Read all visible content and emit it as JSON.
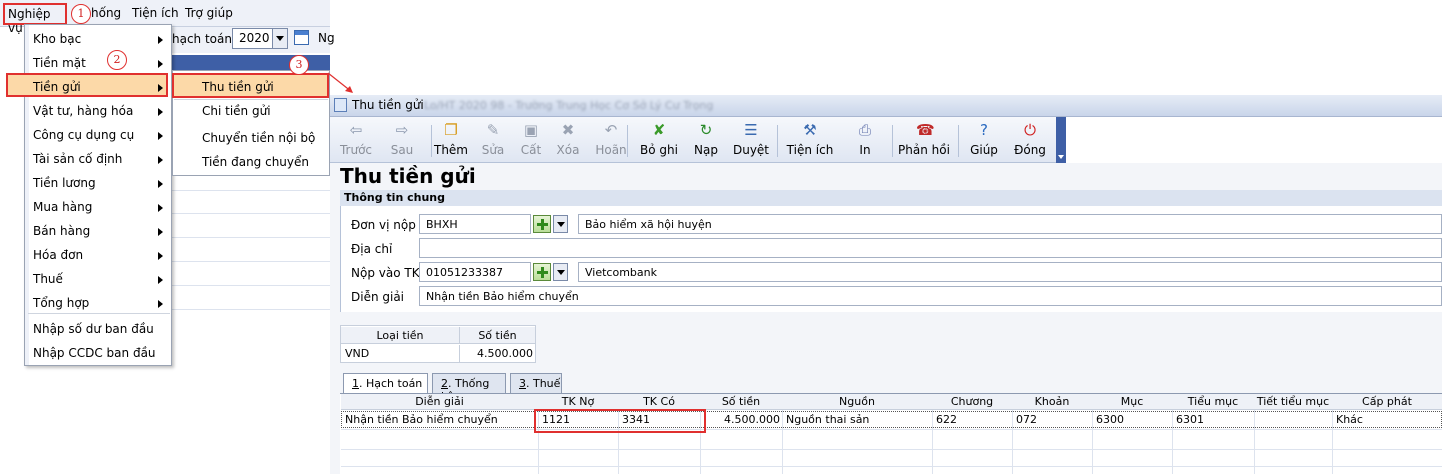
{
  "menubar": {
    "items": [
      "Nghiệp vụ",
      "hống",
      "Tiện ích",
      "Trợ giúp"
    ]
  },
  "bg": {
    "year": "2020",
    "hach_toan": "hạch toán",
    "n": "Ng"
  },
  "menu1": {
    "items": [
      "Kho bạc",
      "Tiền mặt",
      "Tiền gửi",
      "Vật tư, hàng hóa",
      "Công cụ dụng cụ",
      "Tài sản cố định",
      "Tiền lương",
      "Mua hàng",
      "Bán hàng",
      "Hóa đơn",
      "Thuế",
      "Tổng hợp",
      "Nhập số dư ban đầu",
      "Nhập CCDC ban đầu"
    ]
  },
  "menu2": {
    "items": [
      "Thu tiền gửi",
      "Chi tiền gửi",
      "Chuyển tiền nội bộ",
      "Tiền đang chuyển"
    ]
  },
  "callouts": [
    "1",
    "2",
    "3"
  ],
  "window": {
    "title": "Thu tiền gửi",
    "blurred_title": "Lo/HT 2020 98 - Trường Trung Học Cơ Sở Lý Cư Trọng"
  },
  "toolbar": [
    "Trước",
    "Sau",
    "Thêm",
    "Sửa",
    "Cất",
    "Xóa",
    "Hoãn",
    "Bỏ ghi",
    "Nạp",
    "Duyệt",
    "Tiện ích",
    "In",
    "Phản hồi",
    "Giúp",
    "Đóng"
  ],
  "form": {
    "title": "Thu tiền gửi",
    "group": "Thông tin chung",
    "labels": {
      "don_vi_nop": "Đơn vị nộp",
      "dia_chi": "Địa chỉ",
      "nop_vao_tk": "Nộp vào TK",
      "dien_giai": "Diễn giải"
    },
    "don_vi_nop_code": "BHXH",
    "don_vi_nop_name": "Bảo hiểm xã hội huyện",
    "dia_chi": "",
    "tk_code": "01051233387",
    "tk_name": "Vietcombank",
    "dien_giai": "Nhận tiền Bảo hiểm chuyển"
  },
  "currency": {
    "headers": [
      "Loại tiền",
      "Số tiền"
    ],
    "row": [
      "VND",
      "4.500.000"
    ]
  },
  "tabs": [
    {
      "num": "1",
      "label": ". Hạch toán"
    },
    {
      "num": "2",
      "label": ". Thống kê"
    },
    {
      "num": "3",
      "label": ". Thuế"
    }
  ],
  "grid": {
    "headers": [
      "Diễn giải",
      "TK Nợ",
      "TK Có",
      "Số tiền",
      "Nguồn",
      "Chương",
      "Khoản",
      "Mục",
      "Tiểu mục",
      "Tiết tiểu mục",
      "Cấp phát"
    ],
    "row": [
      "Nhận tiền Bảo hiểm chuyển",
      "1121",
      "3341",
      "4.500.000",
      "Nguồn thai sản",
      "622",
      "072",
      "6300",
      "6301",
      "",
      "Khác"
    ]
  },
  "colors": {
    "highlight": "#e0302f",
    "menu_selected": "#fcd9a8",
    "titlebar": "#c9d5ea"
  }
}
